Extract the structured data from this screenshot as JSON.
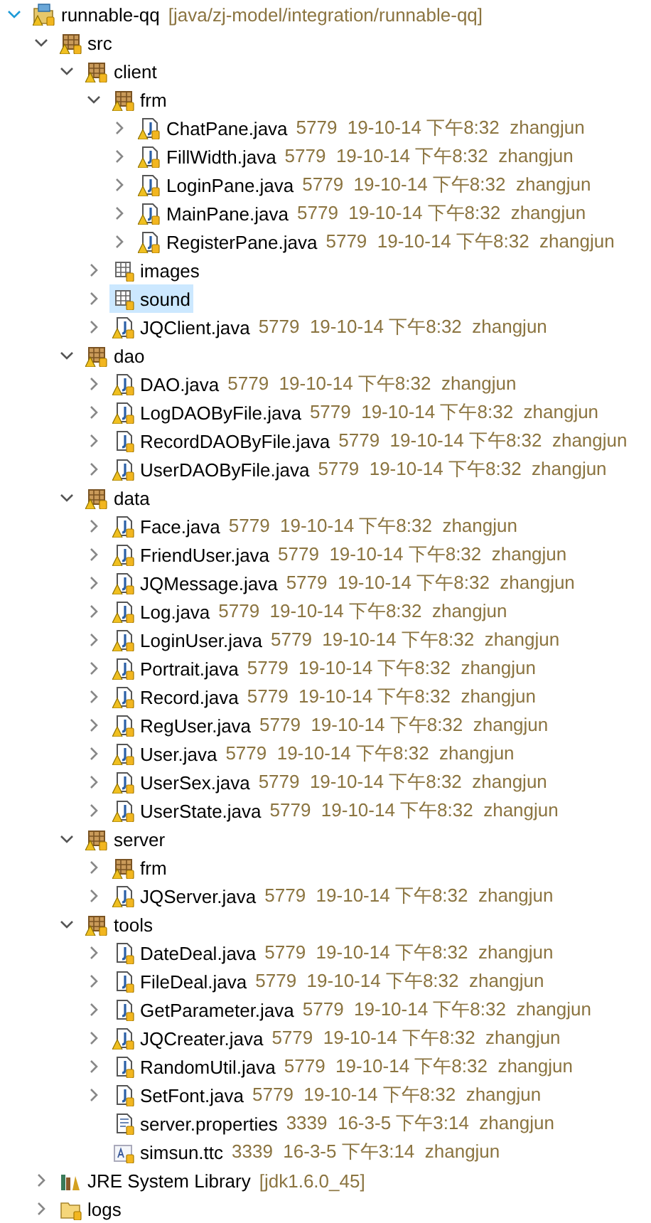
{
  "tree": [
    {
      "kind": "project",
      "name": "runnable-qq",
      "info": "[java/zj-model/integration/runnable-qq]",
      "warning": true,
      "expanded": true,
      "selected": false,
      "children": [
        {
          "kind": "source",
          "name": "src",
          "warning": true,
          "expanded": true,
          "selected": false,
          "children": [
            {
              "kind": "package",
              "name": "client",
              "warning": true,
              "expanded": true,
              "selected": false,
              "children": [
                {
                  "kind": "package",
                  "name": "frm",
                  "warning": true,
                  "expanded": true,
                  "selected": false,
                  "children": [
                    {
                      "kind": "java",
                      "name": "ChatPane.java",
                      "info": "5779  19-10-14 下午8:32  zhangjun",
                      "warning": true,
                      "expanded": false,
                      "selected": false
                    },
                    {
                      "kind": "java",
                      "name": "FillWidth.java",
                      "info": "5779  19-10-14 下午8:32  zhangjun",
                      "warning": true,
                      "expanded": false,
                      "selected": false
                    },
                    {
                      "kind": "java",
                      "name": "LoginPane.java",
                      "info": "5779  19-10-14 下午8:32  zhangjun",
                      "warning": true,
                      "expanded": false,
                      "selected": false
                    },
                    {
                      "kind": "java",
                      "name": "MainPane.java",
                      "info": "5779  19-10-14 下午8:32  zhangjun",
                      "warning": true,
                      "expanded": false,
                      "selected": false
                    },
                    {
                      "kind": "java",
                      "name": "RegisterPane.java",
                      "info": "5779  19-10-14 下午8:32  zhangjun",
                      "warning": true,
                      "expanded": false,
                      "selected": false
                    }
                  ]
                },
                {
                  "kind": "resources",
                  "name": "images",
                  "warning": false,
                  "expanded": false,
                  "selected": false
                },
                {
                  "kind": "resources",
                  "name": "sound",
                  "warning": false,
                  "expanded": false,
                  "selected": true
                },
                {
                  "kind": "java",
                  "name": "JQClient.java",
                  "info": "5779  19-10-14 下午8:32  zhangjun",
                  "warning": true,
                  "expanded": false,
                  "selected": false
                }
              ]
            },
            {
              "kind": "package",
              "name": "dao",
              "warning": true,
              "expanded": true,
              "selected": false,
              "children": [
                {
                  "kind": "java",
                  "name": "DAO.java",
                  "info": "5779  19-10-14 下午8:32  zhangjun",
                  "warning": true,
                  "expanded": false,
                  "selected": false
                },
                {
                  "kind": "java",
                  "name": "LogDAOByFile.java",
                  "info": "5779  19-10-14 下午8:32  zhangjun",
                  "warning": true,
                  "expanded": false,
                  "selected": false
                },
                {
                  "kind": "java",
                  "name": "RecordDAOByFile.java",
                  "info": "5779  19-10-14 下午8:32  zhangjun",
                  "warning": false,
                  "expanded": false,
                  "selected": false
                },
                {
                  "kind": "java",
                  "name": "UserDAOByFile.java",
                  "info": "5779  19-10-14 下午8:32  zhangjun",
                  "warning": true,
                  "expanded": false,
                  "selected": false
                }
              ]
            },
            {
              "kind": "package",
              "name": "data",
              "warning": true,
              "expanded": true,
              "selected": false,
              "children": [
                {
                  "kind": "java",
                  "name": "Face.java",
                  "info": "5779  19-10-14 下午8:32  zhangjun",
                  "warning": true,
                  "expanded": false,
                  "selected": false
                },
                {
                  "kind": "java",
                  "name": "FriendUser.java",
                  "info": "5779  19-10-14 下午8:32  zhangjun",
                  "warning": true,
                  "expanded": false,
                  "selected": false
                },
                {
                  "kind": "java",
                  "name": "JQMessage.java",
                  "info": "5779  19-10-14 下午8:32  zhangjun",
                  "warning": true,
                  "expanded": false,
                  "selected": false
                },
                {
                  "kind": "java",
                  "name": "Log.java",
                  "info": "5779  19-10-14 下午8:32  zhangjun",
                  "warning": true,
                  "expanded": false,
                  "selected": false
                },
                {
                  "kind": "java",
                  "name": "LoginUser.java",
                  "info": "5779  19-10-14 下午8:32  zhangjun",
                  "warning": true,
                  "expanded": false,
                  "selected": false
                },
                {
                  "kind": "java",
                  "name": "Portrait.java",
                  "info": "5779  19-10-14 下午8:32  zhangjun",
                  "warning": true,
                  "expanded": false,
                  "selected": false
                },
                {
                  "kind": "java",
                  "name": "Record.java",
                  "info": "5779  19-10-14 下午8:32  zhangjun",
                  "warning": true,
                  "expanded": false,
                  "selected": false
                },
                {
                  "kind": "java",
                  "name": "RegUser.java",
                  "info": "5779  19-10-14 下午8:32  zhangjun",
                  "warning": true,
                  "expanded": false,
                  "selected": false
                },
                {
                  "kind": "java",
                  "name": "User.java",
                  "info": "5779  19-10-14 下午8:32  zhangjun",
                  "warning": true,
                  "expanded": false,
                  "selected": false
                },
                {
                  "kind": "java",
                  "name": "UserSex.java",
                  "info": "5779  19-10-14 下午8:32  zhangjun",
                  "warning": true,
                  "expanded": false,
                  "selected": false
                },
                {
                  "kind": "java",
                  "name": "UserState.java",
                  "info": "5779  19-10-14 下午8:32  zhangjun",
                  "warning": true,
                  "expanded": false,
                  "selected": false
                }
              ]
            },
            {
              "kind": "package",
              "name": "server",
              "warning": true,
              "expanded": true,
              "selected": false,
              "children": [
                {
                  "kind": "package",
                  "name": "frm",
                  "warning": true,
                  "expanded": false,
                  "selected": false
                },
                {
                  "kind": "java",
                  "name": "JQServer.java",
                  "info": "5779  19-10-14 下午8:32  zhangjun",
                  "warning": true,
                  "expanded": false,
                  "selected": false
                }
              ]
            },
            {
              "kind": "package",
              "name": "tools",
              "warning": true,
              "expanded": true,
              "selected": false,
              "children": [
                {
                  "kind": "java",
                  "name": "DateDeal.java",
                  "info": "5779  19-10-14 下午8:32  zhangjun",
                  "warning": false,
                  "expanded": false,
                  "selected": false
                },
                {
                  "kind": "java",
                  "name": "FileDeal.java",
                  "info": "5779  19-10-14 下午8:32  zhangjun",
                  "warning": false,
                  "expanded": false,
                  "selected": false
                },
                {
                  "kind": "java",
                  "name": "GetParameter.java",
                  "info": "5779  19-10-14 下午8:32  zhangjun",
                  "warning": false,
                  "expanded": false,
                  "selected": false
                },
                {
                  "kind": "java",
                  "name": "JQCreater.java",
                  "info": "5779  19-10-14 下午8:32  zhangjun",
                  "warning": true,
                  "expanded": false,
                  "selected": false
                },
                {
                  "kind": "java",
                  "name": "RandomUtil.java",
                  "info": "5779  19-10-14 下午8:32  zhangjun",
                  "warning": false,
                  "expanded": false,
                  "selected": false
                },
                {
                  "kind": "java",
                  "name": "SetFont.java",
                  "info": "5779  19-10-14 下午8:32  zhangjun",
                  "warning": false,
                  "expanded": false,
                  "selected": false
                },
                {
                  "kind": "properties",
                  "name": "server.properties",
                  "info": "3339  16-3-5 下午3:14  zhangjun",
                  "warning": false,
                  "selected": false
                },
                {
                  "kind": "font",
                  "name": "simsun.ttc",
                  "info": "3339  16-3-5 下午3:14  zhangjun",
                  "warning": false,
                  "selected": false
                }
              ]
            }
          ]
        },
        {
          "kind": "library",
          "name": "JRE System Library",
          "info": "[jdk1.6.0_45]",
          "warning": false,
          "expanded": false,
          "selected": false
        },
        {
          "kind": "folder",
          "name": "logs",
          "warning": false,
          "expanded": false,
          "selected": false
        }
      ]
    }
  ]
}
